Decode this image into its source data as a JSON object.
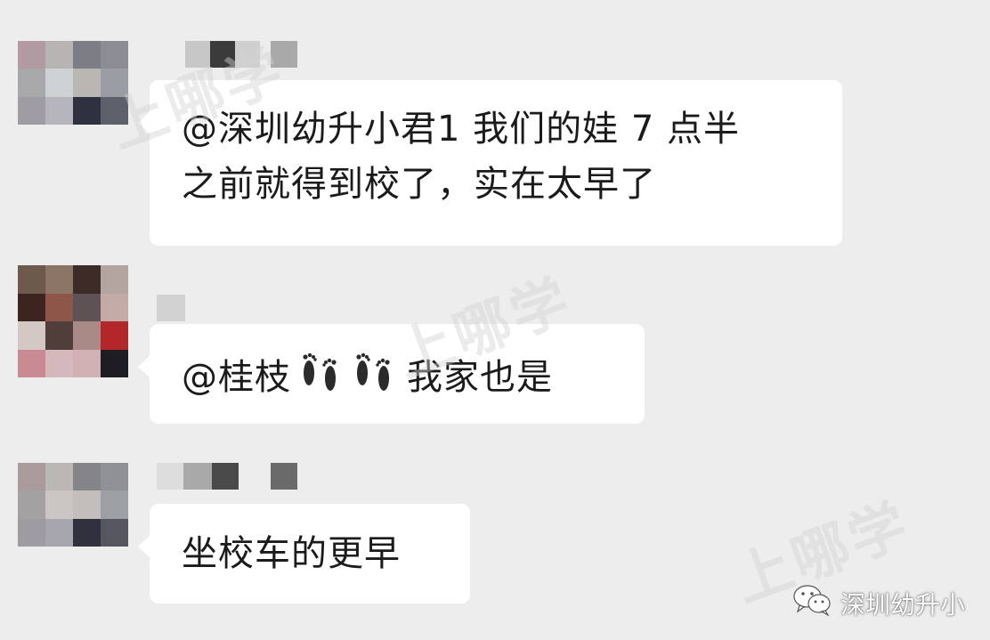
{
  "messages": [
    {
      "mention": "@深圳幼升小君1",
      "text_line1": "我们的娃 7 点半",
      "text_line2": "之前就得到校了，实在太早了"
    },
    {
      "mention": "@桂枝",
      "emoji": "footprints-emoji",
      "text": "我家也是"
    },
    {
      "text": "坐校车的更早"
    }
  ],
  "watermark": {
    "text": "上哪学"
  },
  "brand": {
    "icon": "wechat-icon",
    "label": "深圳幼升小"
  }
}
